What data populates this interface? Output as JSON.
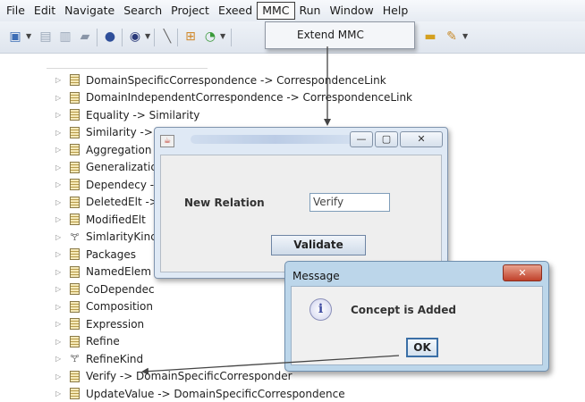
{
  "menubar": {
    "items": [
      {
        "label": "File"
      },
      {
        "label": "Edit"
      },
      {
        "label": "Navigate"
      },
      {
        "label": "Search"
      },
      {
        "label": "Project"
      },
      {
        "label": "Exeed"
      },
      {
        "label": "MMC",
        "active": true
      },
      {
        "label": "Run"
      },
      {
        "label": "Window"
      },
      {
        "label": "Help"
      }
    ]
  },
  "dropdown": {
    "item": "Extend MMC"
  },
  "tree": {
    "items": [
      {
        "label": "DomainSpecificCorrespondence -> CorrespondenceLink",
        "icon": "class-icon"
      },
      {
        "label": "DomainIndependentCorrespondence -> CorrespondenceLink",
        "icon": "class-icon"
      },
      {
        "label": "Equality -> Similarity",
        "icon": "class-icon"
      },
      {
        "label": "Similarity ->",
        "icon": "class-icon"
      },
      {
        "label": "Aggregation",
        "icon": "class-icon"
      },
      {
        "label": "Generalizatic",
        "icon": "class-icon"
      },
      {
        "label": "Dependecy -",
        "icon": "class-icon"
      },
      {
        "label": "DeletedElt ->",
        "icon": "class-icon"
      },
      {
        "label": "ModifiedElt",
        "icon": "class-icon"
      },
      {
        "label": "SimlarityKinc",
        "icon": "enum-icon"
      },
      {
        "label": "Packages",
        "icon": "class-icon"
      },
      {
        "label": "NamedElem",
        "icon": "class-icon"
      },
      {
        "label": "CoDependec",
        "icon": "class-icon"
      },
      {
        "label": "Composition",
        "icon": "class-icon"
      },
      {
        "label": "Expression",
        "icon": "class-icon"
      },
      {
        "label": "Refine",
        "icon": "class-icon"
      },
      {
        "label": "RefineKind",
        "icon": "enum-icon"
      },
      {
        "label": "Verify -> DomainSpecificCorresponder",
        "icon": "class-icon"
      },
      {
        "label": "UpdateValue -> DomainSpecificCorrespondence",
        "icon": "class-icon"
      }
    ]
  },
  "dialog": {
    "field_label": "New Relation",
    "field_value": "Verify",
    "button_label": "Validate",
    "window_buttons": {
      "minimize": "—",
      "maximize": "▢",
      "close": "✕"
    }
  },
  "message": {
    "title": "Message",
    "text": "Concept is Added",
    "ok_label": "OK",
    "info_glyph": "i",
    "close_glyph": "✕"
  }
}
